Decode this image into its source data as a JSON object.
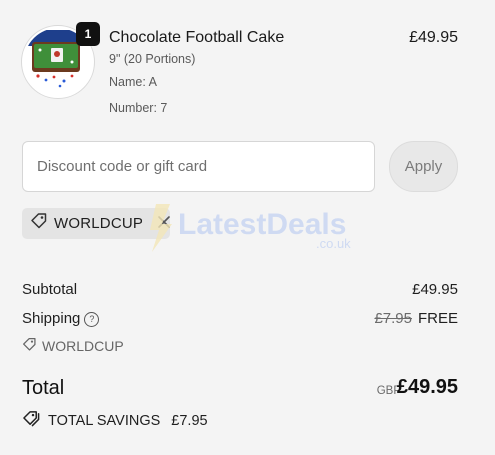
{
  "product": {
    "quantity": "1",
    "title": "Chocolate Football Cake",
    "price": "£49.95",
    "size": "9\" (20 Portions)",
    "name_line": "Name: A",
    "number_line": "Number: 7",
    "thumbnail_icon": "cake-image"
  },
  "discount": {
    "placeholder": "Discount code or gift card",
    "value": "",
    "apply_label": "Apply"
  },
  "applied_code": {
    "code": "WORLDCUP",
    "tag_icon": "tag-icon",
    "remove_icon": "close-icon"
  },
  "watermark": {
    "brand": "LatestDeals",
    "domain": ".co.uk"
  },
  "summary": {
    "subtotal_label": "Subtotal",
    "subtotal_value": "£49.95",
    "shipping_label": "Shipping",
    "shipping_original": "£7.95",
    "shipping_value": "FREE",
    "shipping_code": "WORLDCUP"
  },
  "total": {
    "label": "Total",
    "currency": "GBP",
    "value": "£49.95"
  },
  "savings": {
    "label": "TOTAL SAVINGS",
    "amount": "£7.95"
  },
  "colors": {
    "background": "#f4f4f4",
    "text": "#1f1f1f",
    "muted": "#6b6b6b",
    "badge": "#111111",
    "chip": "#e4e4e4",
    "watermark": "#c9d6f2"
  }
}
